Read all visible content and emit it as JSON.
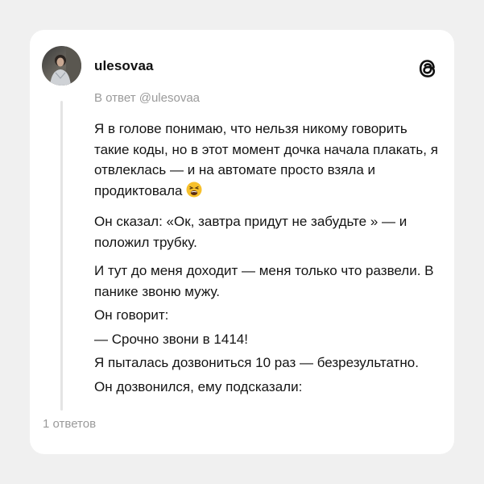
{
  "post": {
    "username": "ulesovaa",
    "reply_to": "В ответ @ulesovaa",
    "paragraphs": [
      "Я в голове понимаю, что нельзя никому говорить такие коды, но в этот момент дочка начала плакать, я отвлеклась — и на автомате просто взяла и продиктовала",
      "Он сказал: «Ок, завтра придут не забудьте » — и положил трубку.",
      "И тут до меня доходит — меня только что развели. В панике звоню мужу.",
      "Он говорит:",
      "— Срочно звони в 1414!",
      "Я пыталась дозвониться 10 раз — безрезультатно.",
      "Он дозвонился, ему подсказали:"
    ],
    "emoji": "weary-face-emoji",
    "replies_count": "1 ответов"
  },
  "icons": {
    "brand": "threads-logo-icon",
    "avatar": "profile-photo"
  },
  "colors": {
    "background": "#f0f0f0",
    "card": "#ffffff",
    "text": "#141414",
    "muted": "#9a9a9a",
    "thread_line": "#e4e4e4"
  }
}
